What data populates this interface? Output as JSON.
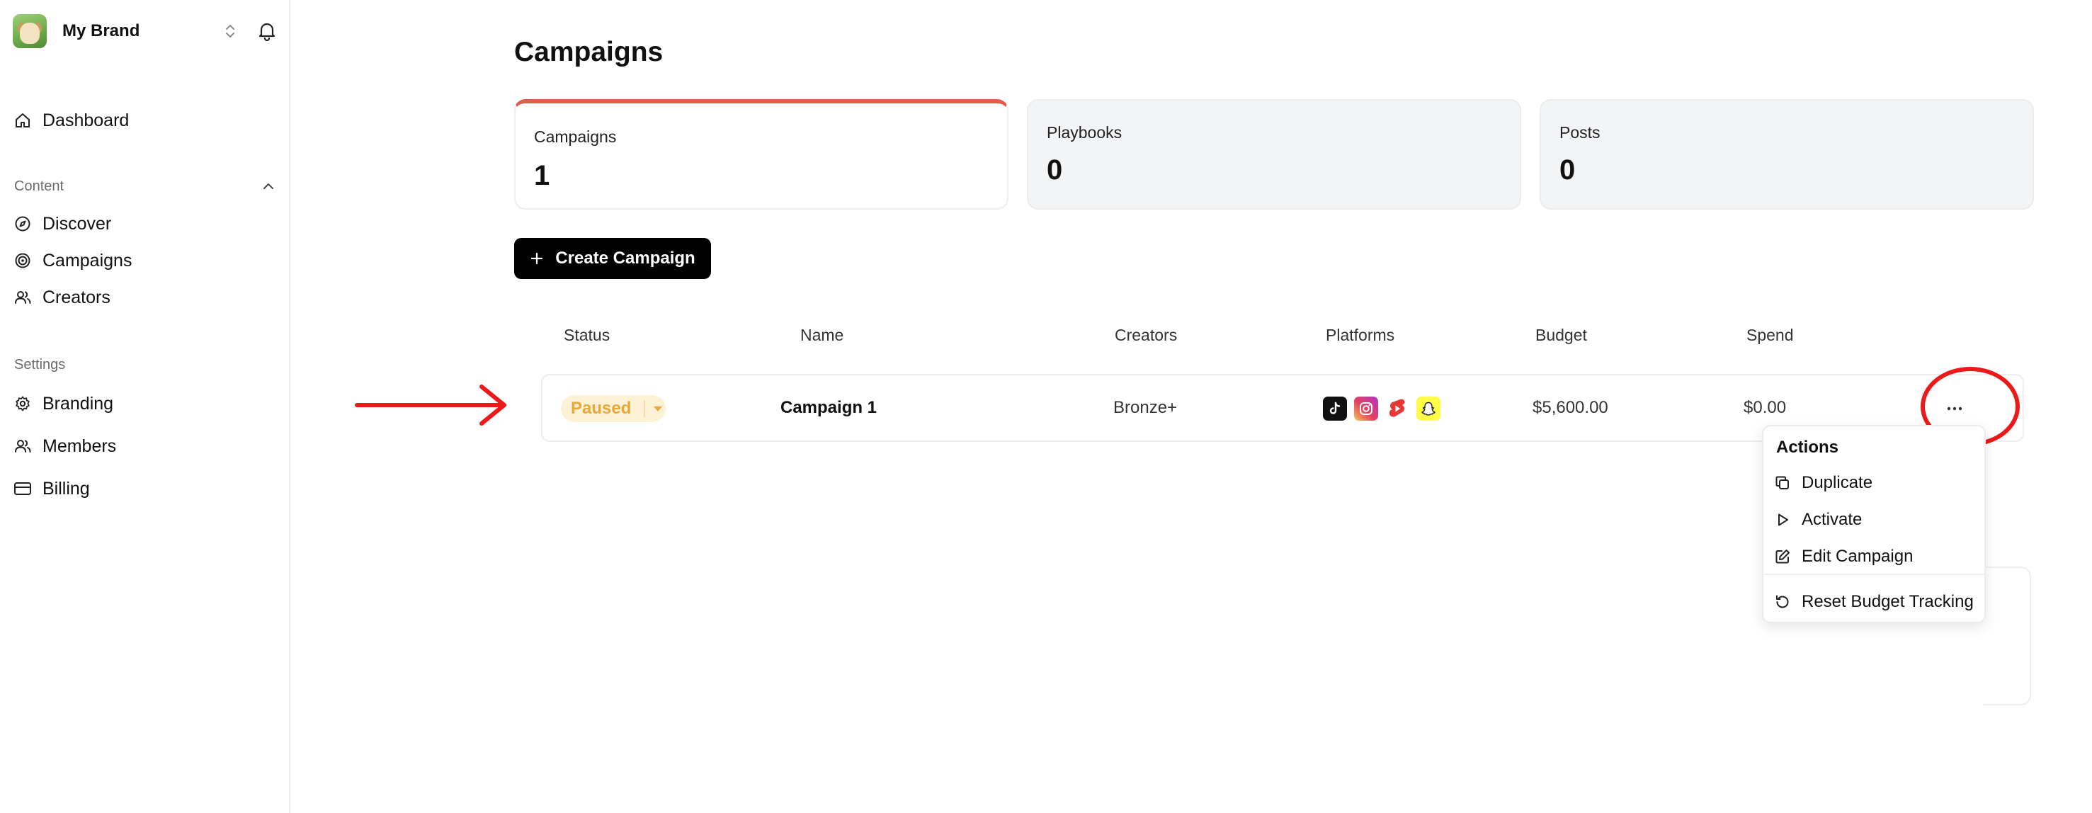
{
  "sidebar": {
    "brand_name": "My Brand",
    "nav_top": [
      {
        "label": "Dashboard",
        "icon": "home-icon"
      }
    ],
    "sections": [
      {
        "label": "Content",
        "expanded": true,
        "items": [
          {
            "label": "Discover",
            "icon": "compass-icon"
          },
          {
            "label": "Campaigns",
            "icon": "target-icon"
          },
          {
            "label": "Creators",
            "icon": "users-icon"
          }
        ]
      },
      {
        "label": "Settings",
        "items": [
          {
            "label": "Branding",
            "icon": "gear-icon"
          },
          {
            "label": "Members",
            "icon": "users-icon"
          },
          {
            "label": "Billing",
            "icon": "credit-card-icon"
          }
        ]
      }
    ]
  },
  "main": {
    "title": "Campaigns",
    "stats": [
      {
        "label": "Campaigns",
        "value": "1",
        "active": true
      },
      {
        "label": "Playbooks",
        "value": "0"
      },
      {
        "label": "Posts",
        "value": "0"
      }
    ],
    "create_button": "Create Campaign",
    "table": {
      "columns": [
        "Status",
        "Name",
        "Creators",
        "Platforms",
        "Budget",
        "Spend"
      ],
      "rows": [
        {
          "status": "Paused",
          "name": "Campaign 1",
          "creators": "Bronze+",
          "platforms": [
            "tiktok-icon",
            "instagram-icon",
            "youtube-shorts-icon",
            "snapchat-icon"
          ],
          "budget": "$5,600.00",
          "spend": "$0.00"
        }
      ]
    }
  },
  "actions_menu": {
    "title": "Actions",
    "items": [
      {
        "label": "Duplicate",
        "icon": "copy-icon"
      },
      {
        "label": "Activate",
        "icon": "play-icon"
      },
      {
        "label": "Edit Campaign",
        "icon": "edit-icon"
      },
      {
        "label": "Reset Budget Tracking",
        "icon": "reset-icon"
      }
    ]
  },
  "colors": {
    "accent_red": "#e25b4c",
    "annotation_red": "#ea1a1a",
    "paused_text": "#e8a93a",
    "paused_bg": "#fdf1d6"
  }
}
